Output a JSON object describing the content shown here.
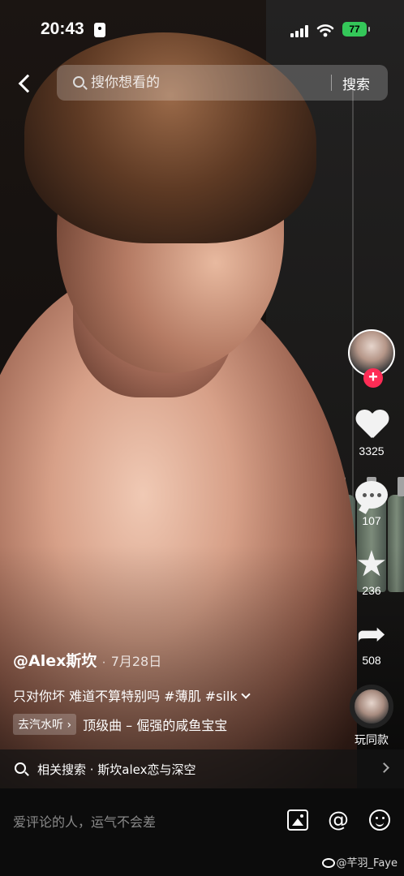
{
  "status": {
    "time": "20:43",
    "battery": "77"
  },
  "search": {
    "placeholder": "搜你想看的",
    "submit_label": "搜索"
  },
  "rail": {
    "likes": "3325",
    "comments": "107",
    "favorites": "236",
    "shares": "508",
    "same_label": "玩同款",
    "follow_symbol": "+"
  },
  "icons": {
    "back": "back-chevron-icon",
    "search": "search-icon",
    "like": "heart-icon",
    "comment": "comment-bubble-icon",
    "favorite": "star-icon",
    "share": "share-arrow-icon",
    "image": "image-icon",
    "at": "at-icon",
    "emoji": "emoji-icon"
  },
  "video": {
    "author": "@Alex斯坎",
    "date": "7月28日",
    "caption": "只对你坏 难道不算特别吗 #薄肌 #silk",
    "music_tag": "去汽水听",
    "music_title": "顶级曲 – 倔强的咸鱼宝宝"
  },
  "related": {
    "text": "相关搜索 · 斯坎alex恋与深空"
  },
  "comment": {
    "placeholder": "爱评论的人，运气不会差",
    "at_symbol": "@"
  },
  "watermark": "@芊羽_Faye",
  "colors": {
    "follow": "#fe2c55",
    "battery": "#34c759",
    "comment_bar": "#0c0c0c"
  }
}
